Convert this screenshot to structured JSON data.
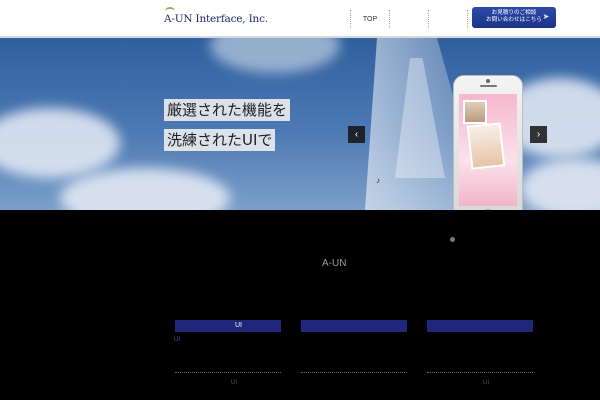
{
  "header": {
    "logo_text": "A-UN Interface, Inc.",
    "nav": [
      "TOP",
      "",
      ""
    ],
    "cta_line1": "お見積りのご相談",
    "cta_line2": "お問い合わせはこちら"
  },
  "hero": {
    "headline_line1": "厳選された機能を",
    "headline_line2": "洗練されたUIで",
    "prev_arrow": "‹",
    "next_arrow": "›",
    "music_note": "♪"
  },
  "section": {
    "title": "A-UN",
    "cards": [
      {
        "label": "　　　UI",
        "note": "UI"
      },
      {
        "label": "　　　　　　　　　",
        "note": ""
      },
      {
        "label": "",
        "note": "UI"
      }
    ],
    "left_note": "UI"
  },
  "colors": {
    "accent": "#20277a",
    "cta": "#2d4aa8"
  }
}
